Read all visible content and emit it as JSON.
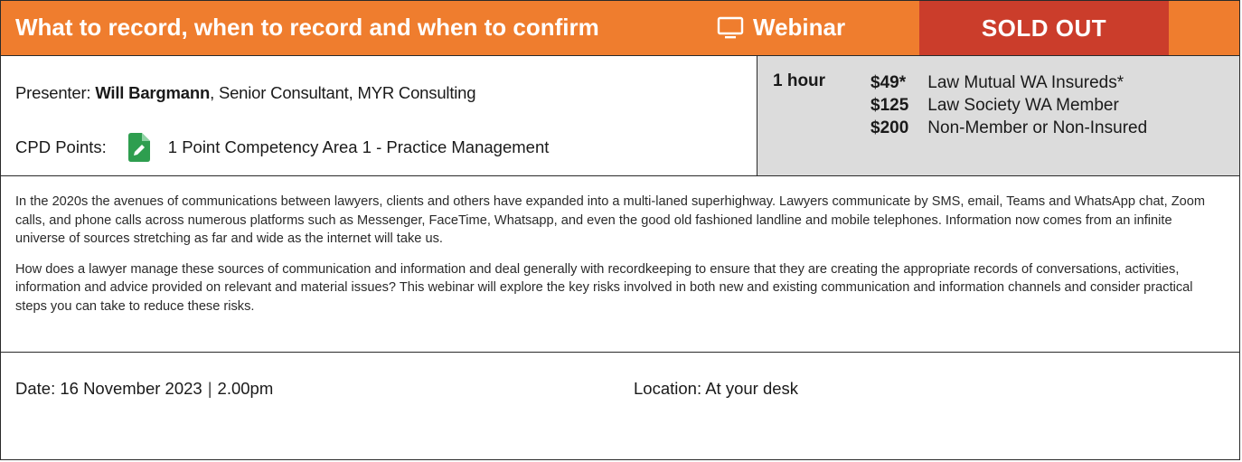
{
  "header": {
    "title": "What to record, when to record and when to confirm",
    "format_icon": "monitor-icon",
    "format_label": "Webinar",
    "status_label": "SOLD OUT",
    "colors": {
      "header_bg": "#ef7d2e",
      "sold_out_bg": "#cb3d2b",
      "pricing_bg": "#dcdcdc"
    }
  },
  "info": {
    "presenter_label": "Presenter:",
    "presenter_name": "Will Bargmann",
    "presenter_role": ", Senior Consultant, MYR Consulting",
    "cpd_label": "CPD Points:",
    "cpd_icon": "document-pen-icon",
    "cpd_value": "1 Point Competency Area 1 - Practice Management"
  },
  "pricing": {
    "duration": "1 hour",
    "rows": [
      {
        "amount": "$49*",
        "label": "Law Mutual WA Insureds*"
      },
      {
        "amount": "$125",
        "label": "Law Society WA Member"
      },
      {
        "amount": "$200",
        "label": "Non-Member or Non-Insured"
      }
    ]
  },
  "description": {
    "paragraphs": [
      "In the 2020s the avenues of communications between lawyers, clients and others have expanded into a multi-laned superhighway. Lawyers communicate by SMS, email, Teams and WhatsApp chat, Zoom calls, and phone calls across numerous platforms such as Messenger, FaceTime, Whatsapp, and even the good old fashioned landline and mobile telephones. Information now comes from an infinite universe of sources stretching as far and wide as the internet will take us.",
      "How does a lawyer manage these sources of communication and information and deal generally with recordkeeping to ensure that they are creating the appropriate records of conversations, activities, information and advice provided on relevant and material issues? This webinar will explore the key risks involved in both new and existing communication and information channels and consider practical steps you can take to reduce these risks."
    ]
  },
  "footer": {
    "date_label": "Date:",
    "date_value": "16 November 2023",
    "separator": "|",
    "time_value": "2.00pm",
    "location_label": "Location:",
    "location_value": "At your desk"
  }
}
